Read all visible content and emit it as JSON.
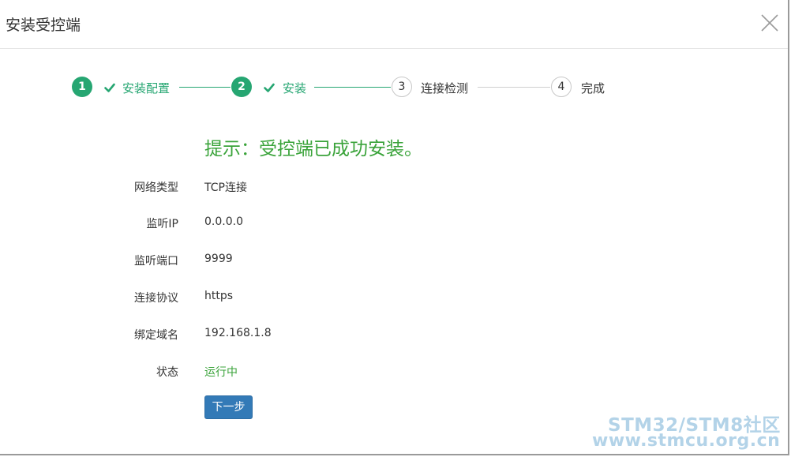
{
  "dialog": {
    "title": "安装受控端"
  },
  "steps": [
    {
      "number": "1",
      "label": "安装配置",
      "state": "done"
    },
    {
      "number": "2",
      "label": "安装",
      "state": "done"
    },
    {
      "number": "3",
      "label": "连接检测",
      "state": "todo"
    },
    {
      "number": "4",
      "label": "完成",
      "state": "todo"
    }
  ],
  "hint": "提示：受控端已成功安装。",
  "fields": [
    {
      "label": "网络类型",
      "value": "TCP连接"
    },
    {
      "label": "监听IP",
      "value": "0.0.0.0"
    },
    {
      "label": "监听端口",
      "value": "9999"
    },
    {
      "label": "连接协议",
      "value": "https"
    },
    {
      "label": "绑定域名",
      "value": "192.168.1.8"
    },
    {
      "label": "状态",
      "value": "运行中"
    }
  ],
  "next_button": "下一步",
  "watermark": {
    "line1": "STM32/STM8社区",
    "line2": "www.stmcu.org.cn"
  },
  "colors": {
    "step_done": "#26a672",
    "success_text": "#3aa33a",
    "primary_button": "#337ab7"
  }
}
